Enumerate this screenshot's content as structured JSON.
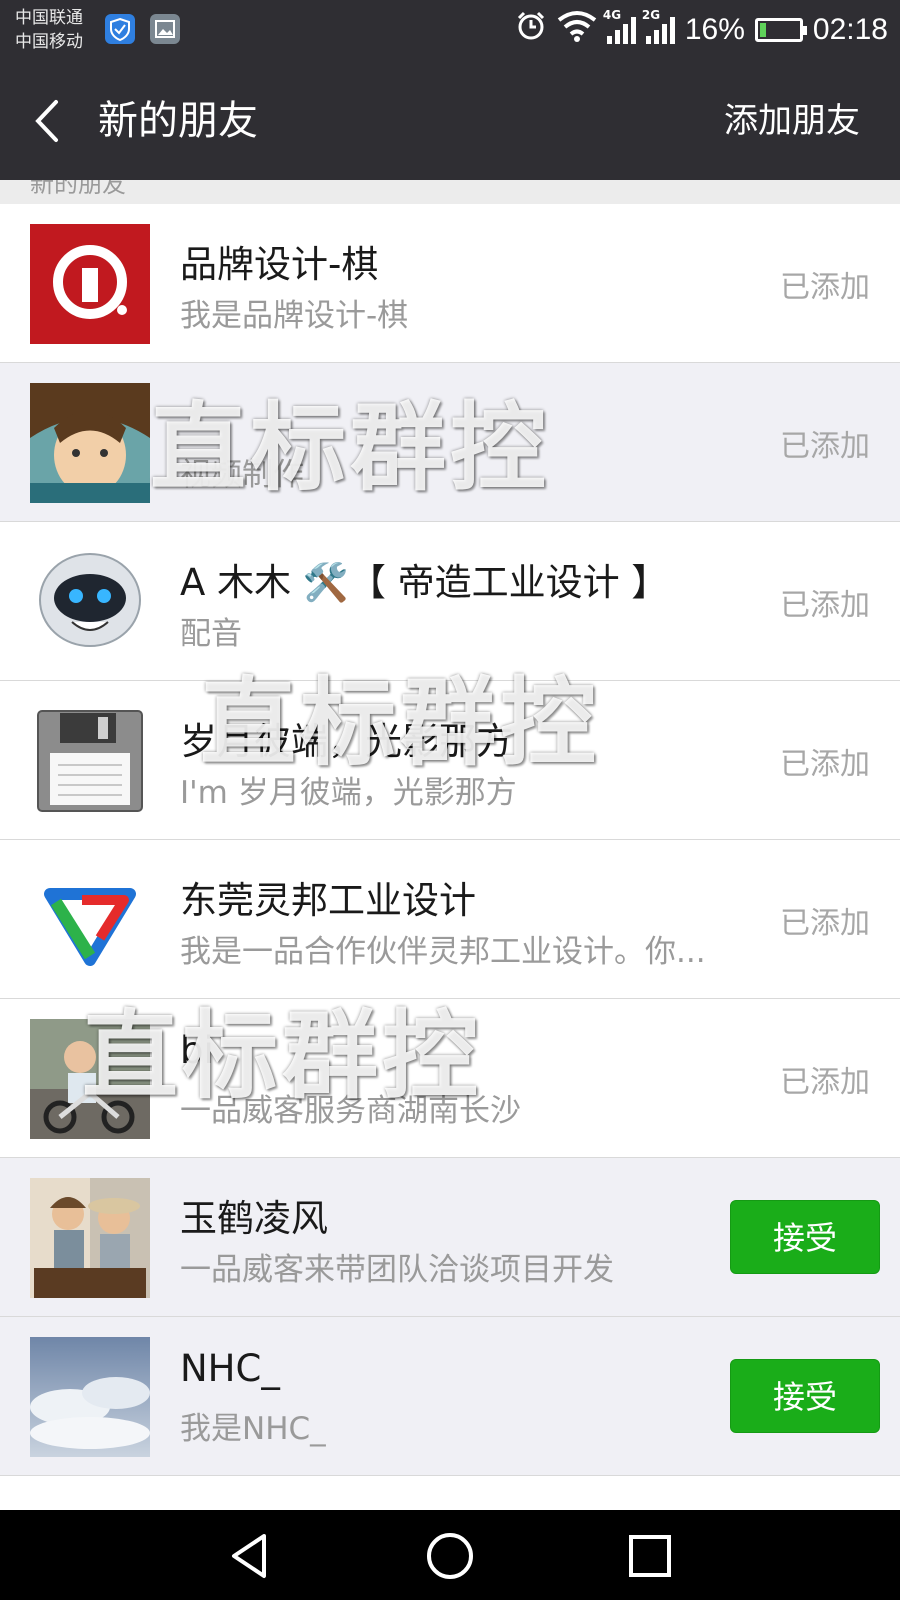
{
  "status_bar": {
    "carrier_1": "中国联通",
    "carrier_2": "中国移动",
    "net_1": "4G",
    "net_2": "2G",
    "battery": "16%",
    "battery_level": 0.16,
    "time": "02:18"
  },
  "header": {
    "title": "新的朋友",
    "add_friend": "添加朋友"
  },
  "section_label": "新的朋友",
  "rows": [
    {
      "name": "品牌设计-棋",
      "message": "我是品牌设计-棋",
      "status": "已添加"
    },
    {
      "name": "",
      "message": "视频制作",
      "status": "已添加"
    },
    {
      "name": "A  木木 🛠️【 帝造工业设计 】",
      "message": "配音",
      "status": "已添加"
    },
    {
      "name": "岁月彼端，光影那方",
      "message": "I'm 岁月彼端，光影那方",
      "status": "已添加"
    },
    {
      "name": "东莞灵邦工业设计",
      "message": "我是一品合作伙伴灵邦工业设计。你...",
      "status": "已添加"
    },
    {
      "name": "bi",
      "message": "一品威客服务商湖南长沙",
      "status": "已添加"
    },
    {
      "name": "玉鹤凌风",
      "message": "一品威客来带团队洽谈项目开发",
      "status": "接受"
    },
    {
      "name": "NHC_",
      "message": "我是NHC_",
      "status": "接受"
    }
  ],
  "watermark": "直标群控",
  "colors": {
    "bar": "#2f2e33",
    "accept_green": "#1aad19",
    "muted": "#a7a7a7"
  }
}
